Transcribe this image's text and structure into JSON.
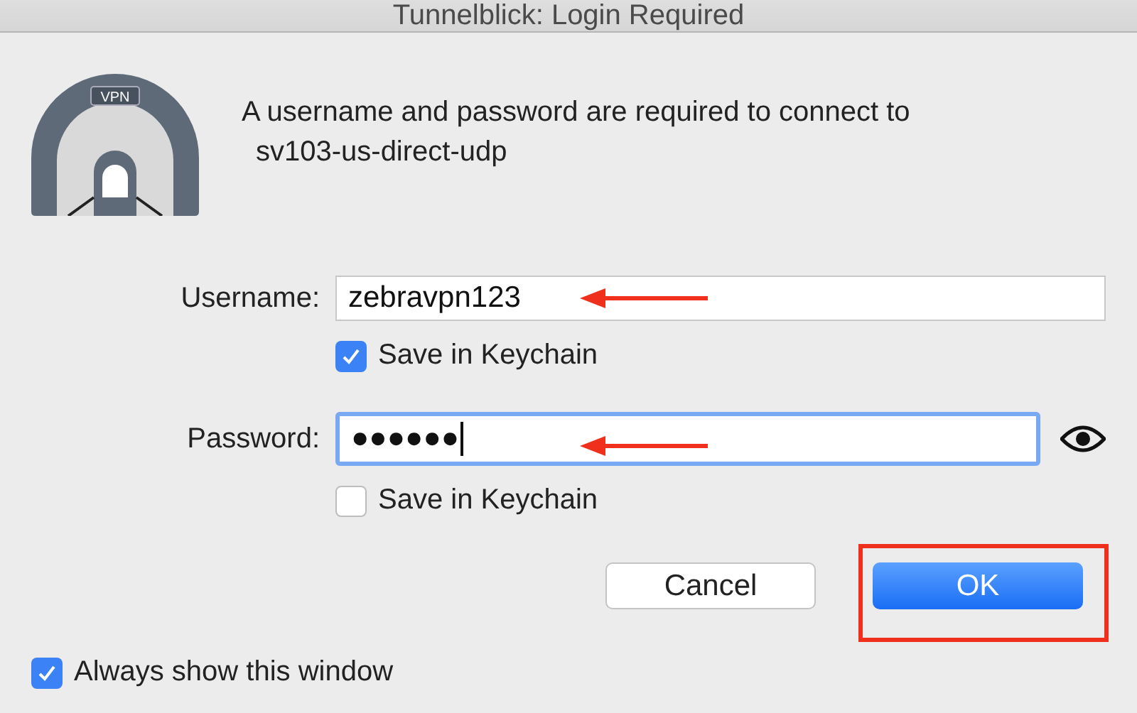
{
  "window": {
    "title": "Tunnelblick: Login Required"
  },
  "message": {
    "line_1": "A username and password are required to connect to",
    "line_2": "sv103-us-direct-udp"
  },
  "icon_badge": "VPN",
  "username": {
    "label": "Username:",
    "value": "zebravpn123",
    "save": {
      "label": "Save in Keychain",
      "checked": true
    },
    "focused": false
  },
  "password": {
    "label": "Password:",
    "value": "●●●●●●",
    "save": {
      "label": "Save in Keychain",
      "checked": false
    },
    "focused": true
  },
  "buttons": [
    {
      "label": "Cancel",
      "kind": "secondary"
    },
    {
      "label": "OK",
      "kind": "default"
    }
  ],
  "always_show": {
    "label": "Always show this window",
    "checked": true
  }
}
